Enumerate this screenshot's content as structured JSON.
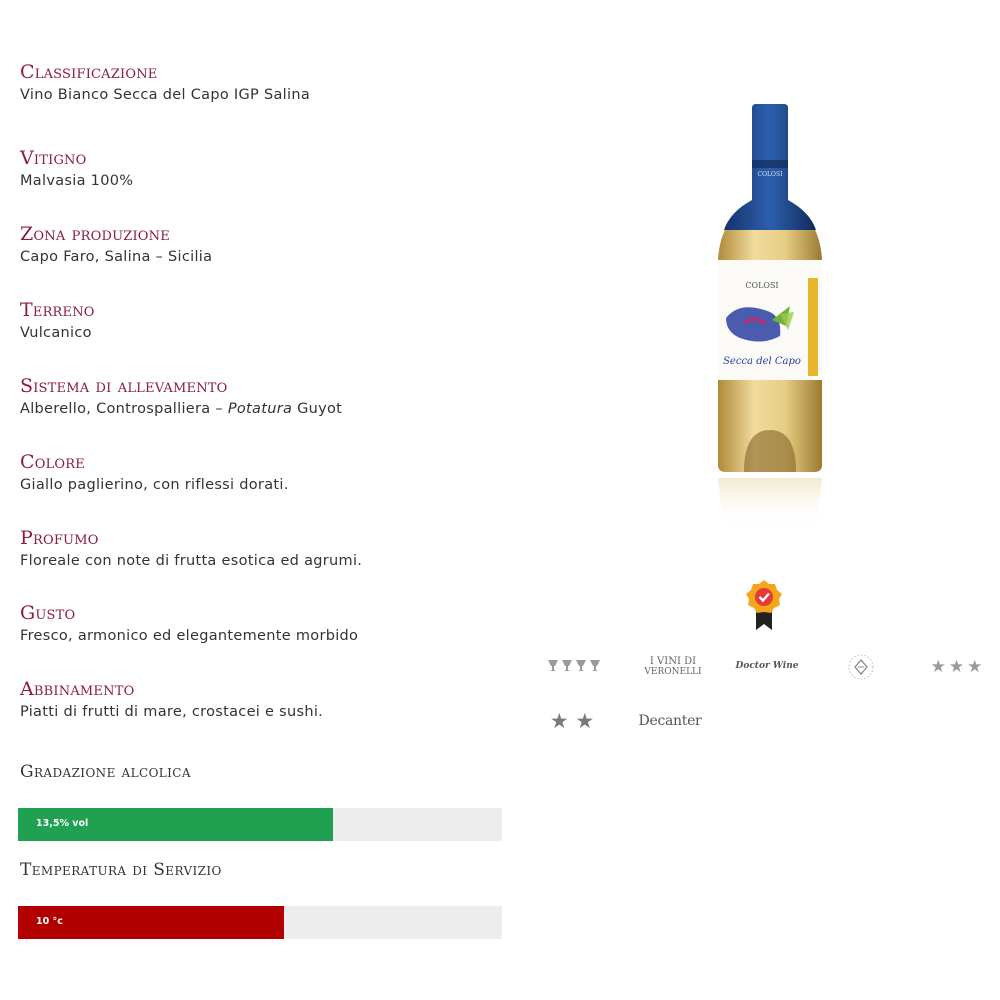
{
  "specs": [
    {
      "label": "Classificazione",
      "value": "Vino Bianco Secca del Capo IGP Salina"
    },
    {
      "label": "Vitigno",
      "value": "Malvasia 100%"
    },
    {
      "label": "Zona produzione",
      "value": "Capo Faro, Salina – Sicilia"
    },
    {
      "label": "Terreno",
      "value": "Vulcanico"
    },
    {
      "label": "Sistema di allevamento",
      "value_pre": "Alberello, Controspalliera – ",
      "value_em": "Potatura",
      "value_post": " Guyot"
    },
    {
      "label": "Colore",
      "value": "Giallo paglierino, con riflessi dorati."
    },
    {
      "label": "Profumo",
      "value": "Floreale con note di frutta esotica ed agrumi."
    },
    {
      "label": "Gusto",
      "value": "Fresco, armonico ed elegantemente morbido"
    },
    {
      "label": "Abbinamento",
      "value": "Piatti di frutti di mare, crostacei e sushi."
    }
  ],
  "meters": {
    "alcohol": {
      "label": "Gradazione alcolica",
      "text": "13,5% vol",
      "fill_fraction": 0.65,
      "color": "#20a152"
    },
    "temperature": {
      "label": "Temperatura di Servizio",
      "text": "10 °c",
      "fill_fraction": 0.55,
      "color": "#b20000"
    }
  },
  "bottle": {
    "brand": "COLOSI",
    "wine_name": "Secca del Capo",
    "capsule_color": "#1f4a8f",
    "wine_color": "#e6cf8a"
  },
  "awards": {
    "badge_icon": "award-ribbon-icon",
    "veronelli_line1": "I VINI DI",
    "veronelli_line2": "VERONELLI",
    "doctor_wine": "Doctor Wine",
    "stars_three": "★★★",
    "stars_two": "★ ★",
    "decanter": "Decanter"
  }
}
